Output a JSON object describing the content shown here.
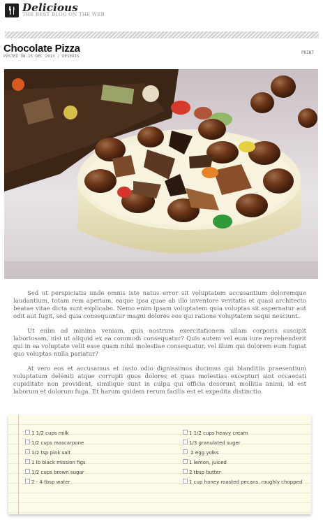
{
  "site": {
    "name": "Delicious",
    "tagline": "THE BEST BLOG ON THE WEB"
  },
  "post": {
    "title": "Chocolate Pizza",
    "meta": "POSTED ON 15 DEC 2013 / DESERTS",
    "print_label": "PRINT",
    "paragraphs": [
      "Sed ut perspiciatis unde omnis iste natus error sit voluptatem accusantium doloremque laudantium, totam rem aperiam, eaque ipsa quae ab illo inventore veritatis et quasi architecto beatae vitae dicta sunt explicabo. Nemo enim ipsam voluptatem quia voluptas sit aspernatur aut odit aut fugit, sed quia consequuntur magni dolores eos qui ratione voluptatem sequi nesciunt.",
      "Ut enim ad minima veniam, quis nostrum exercitationem ullam corporis suscipit laboriosam, nisi ut aliquid ex ea commodi consequatur? Quis autem vel eum iure reprehenderit qui in ea voluptate velit esse quam nihil molestiae consequatur, vel illum qui dolorem eum fugiat quo voluptas nulla pariatur?",
      "At vero eos et accusamus et iusto odio dignissimos ducimus qui blanditiis praesentium voluptatum deleniti atque corrupti quos dolores et quas molestias excepturi sint occaecati cupiditate non provident, similique sunt in culpa qui officia deserunt mollitia animi, id est laborum et dolorum fuga. Et harum quidem rerum facilis est et expedita distinctio."
    ]
  },
  "ingredients": {
    "left": [
      "1 1/2 cups milk",
      "1/2 cups mascarpone",
      "1/2 tsp pink salt",
      "1 lb black mission figs",
      "1/2 cups brown sugar",
      "2 - 4 tbsp water"
    ],
    "right": [
      "1 1/2 cups heavy cream",
      "1/3 granulated suger",
      " 2 egg yolks",
      "1 lemon, juiced",
      "2 tbsp butter",
      "1 cup honey roasted pecans, roughly chopped"
    ]
  },
  "colors": {
    "title": "#111111",
    "body_text": "#666666",
    "card_bg": "#fcfbe7"
  },
  "icons": {
    "logo": "fork-knife-icon",
    "checkbox": "checkbox-icon"
  }
}
